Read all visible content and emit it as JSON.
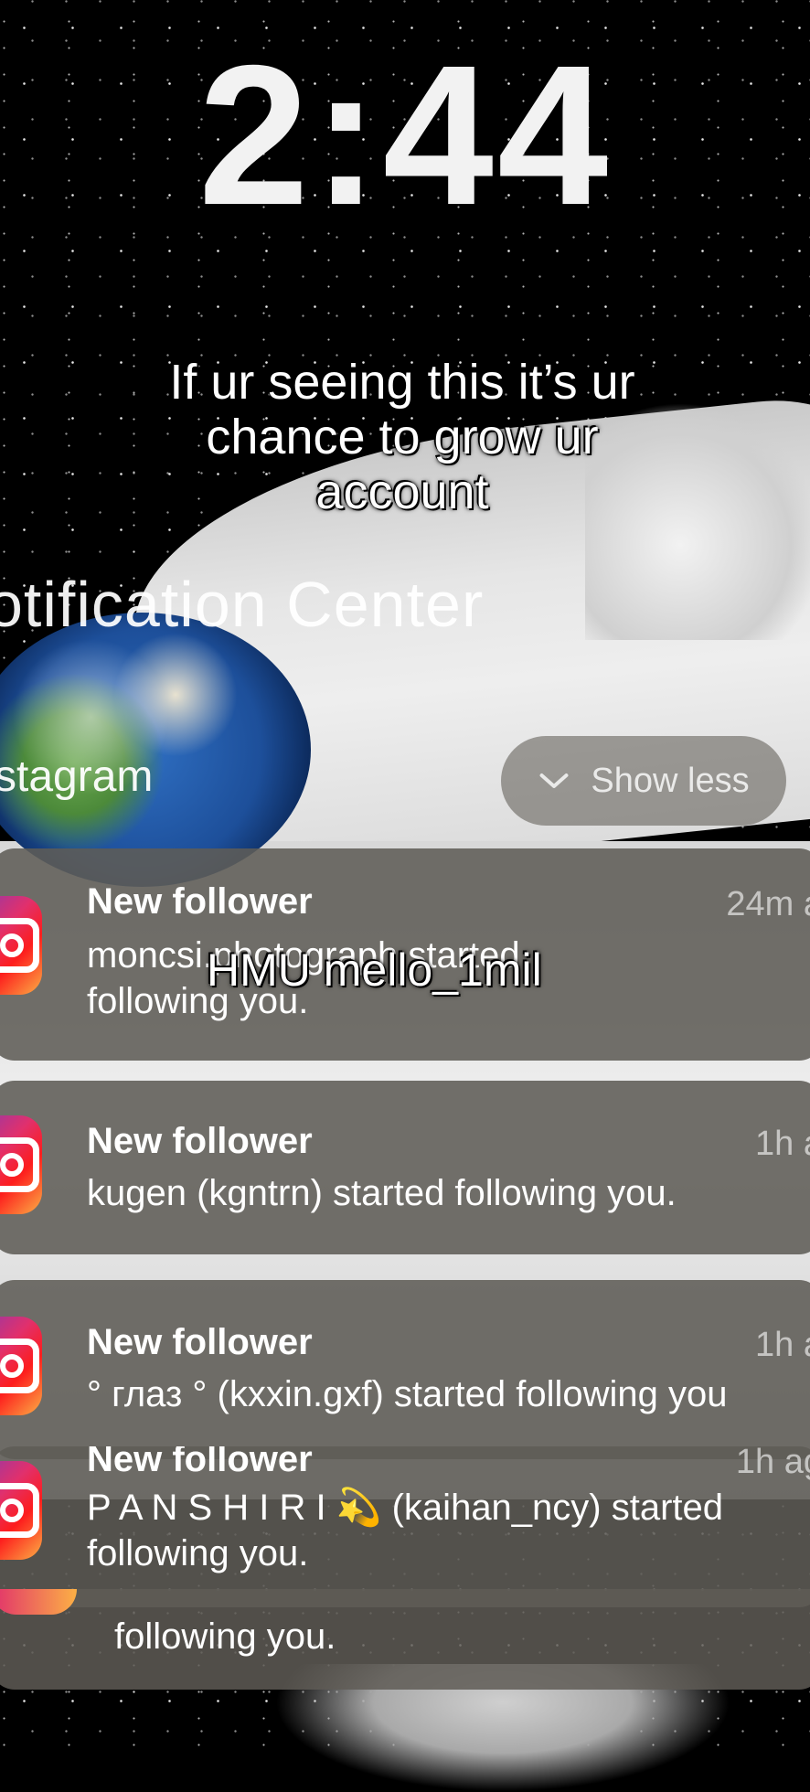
{
  "lock_screen": {
    "time": "2:44"
  },
  "caption": {
    "line1": "If ur seeing this it’s ur",
    "line2": "chance to grow ur",
    "line3": "account"
  },
  "notification_center": {
    "title": "otification Center",
    "app_group": "stagram",
    "show_less_label": "Show less"
  },
  "overlay_text": "HMU mello_1mil",
  "notifications": [
    {
      "title": "New follower",
      "time": "24m a",
      "line1": "moncsi.photograph started",
      "line2": "following you."
    },
    {
      "title": "New follower",
      "time": "1h a",
      "line1": "kugen (kgntrn) started following you."
    },
    {
      "title": "New follower",
      "time": "1h a",
      "line1": "° глаз ° (kxxin.gxf) started following you"
    },
    {
      "title": "New follower",
      "time": "1h ag",
      "line1": "P A N S H I R I 💫 (kaihan_ncy) started",
      "line2": "following you."
    },
    {
      "line1": "following you."
    }
  ],
  "colors": {
    "card_bg": "#5f5c56",
    "instagram_gradient": [
      "#833ab4",
      "#e1306c",
      "#fd1d1d",
      "#fcb045"
    ]
  }
}
